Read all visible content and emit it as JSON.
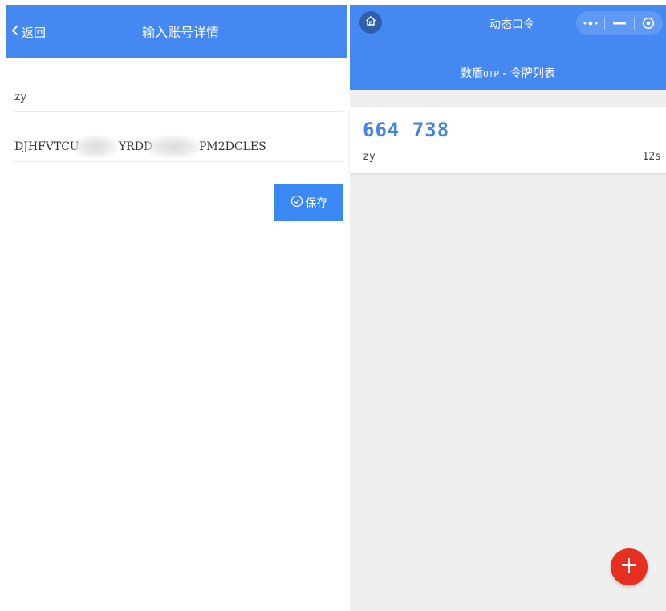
{
  "left_screen": {
    "header": {
      "back_label": "返回",
      "title": "输入账号详情"
    },
    "form": {
      "account_value": "zy",
      "secret_parts": [
        "DJHFVTCU",
        "YRDD",
        "PM2DCLES"
      ]
    },
    "save_label": "保存",
    "colors": {
      "header": "#4688f1",
      "button": "#3a88f4"
    }
  },
  "right_screen": {
    "topbar": {
      "title": "动态口令"
    },
    "subtitle": {
      "part1": "数盾",
      "part2": "OTP",
      "part3": " - 令牌列表"
    },
    "tokens": [
      {
        "code": "664 738",
        "name": "zy",
        "remaining": "12s"
      }
    ],
    "icons": [
      "home-icon",
      "more-icon",
      "minimize-icon",
      "close-icon",
      "plus-icon"
    ],
    "colors": {
      "header": "#4688f1",
      "code": "#4682e6",
      "fab": "#e62e21"
    }
  }
}
